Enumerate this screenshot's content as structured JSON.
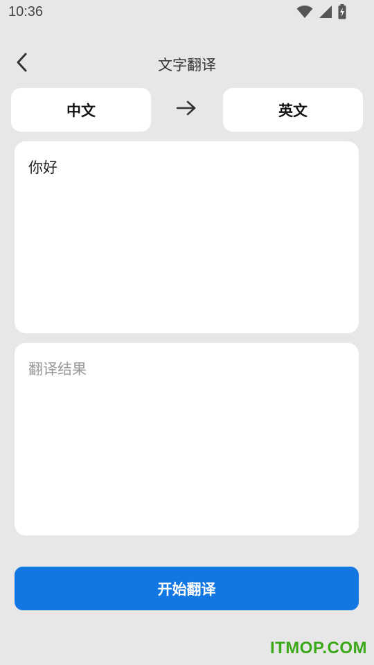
{
  "status_bar": {
    "time": "10:36",
    "icons": [
      "wifi-icon",
      "cellular-signal-icon",
      "battery-charging-icon"
    ]
  },
  "app_bar": {
    "title": "文字翻译",
    "back_icon": "chevron-left-icon"
  },
  "languages": {
    "source": "中文",
    "target": "英文",
    "arrow_icon": "arrow-right-icon"
  },
  "input": {
    "value": "你好",
    "placeholder": ""
  },
  "result": {
    "placeholder": "翻译结果"
  },
  "actions": {
    "translate_label": "开始翻译"
  },
  "watermark": {
    "text": "ITMOP.COM"
  },
  "colors": {
    "background": "#e7e7e7",
    "card": "#ffffff",
    "primary": "#1276e3",
    "placeholder_text": "#9a9a9a",
    "watermark": "#3aa818"
  }
}
